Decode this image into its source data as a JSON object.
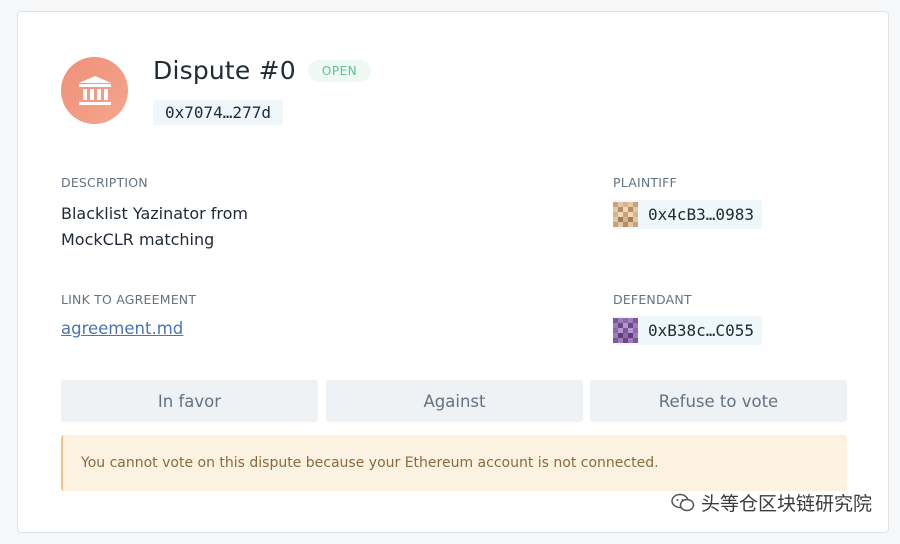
{
  "dispute": {
    "title": "Dispute #0",
    "status": "OPEN",
    "address": "0x7074…277d"
  },
  "description": {
    "label": "DESCRIPTION",
    "text_line1": "Blacklist Yazinator from",
    "text_line2": "MockCLR matching"
  },
  "agreement": {
    "label": "LINK TO AGREEMENT",
    "link_text": "agreement.md"
  },
  "plaintiff": {
    "label": "PLAINTIFF",
    "address": "0x4cB3…0983"
  },
  "defendant": {
    "label": "DEFENDANT",
    "address": "0xB38c…C055"
  },
  "votes": {
    "in_favor": "In favor",
    "against": "Against",
    "refuse": "Refuse to vote"
  },
  "notice": {
    "text": "You cannot vote on this dispute because your Ethereum account is not connected."
  },
  "watermark": {
    "text": "头等仓区块链研究院"
  },
  "colors": {
    "accent_link": "#4a73b8",
    "badge_green": "#56c593",
    "avatar_coral": "#f39c84",
    "notice_bg": "#fcf2e2"
  },
  "icons": {
    "dispute_avatar": "institution-icon",
    "watermark": "wechat-icon"
  }
}
